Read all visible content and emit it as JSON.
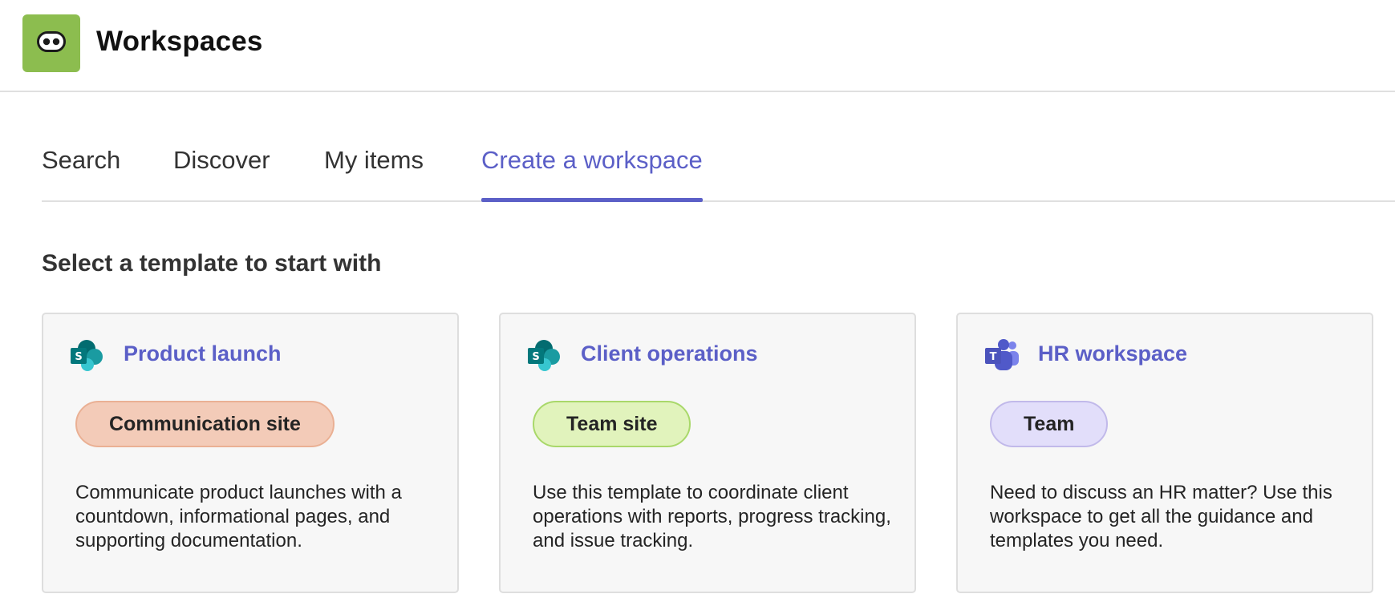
{
  "app": {
    "title": "Workspaces",
    "logo_icon": "eyes-icon",
    "logo_color": "#8cbd4f"
  },
  "tabs": [
    {
      "label": "Search",
      "active": false
    },
    {
      "label": "Discover",
      "active": false
    },
    {
      "label": "My items",
      "active": false
    },
    {
      "label": "Create a workspace",
      "active": true
    }
  ],
  "accent_color": "#5b5fc7",
  "section_title": "Select a template to start with",
  "cards": [
    {
      "title": "Product launch",
      "icon": "sharepoint-icon",
      "badge": "Communication site",
      "badge_color": "#f3cbb8",
      "description": "Communicate product launches with a countdown, informational pages, and supporting documentation."
    },
    {
      "title": "Client operations",
      "icon": "sharepoint-icon",
      "badge": "Team site",
      "badge_color": "#e1f3bc",
      "description": "Use this template to coordinate client operations with reports, progress tracking, and issue tracking."
    },
    {
      "title": "HR workspace",
      "icon": "teams-icon",
      "badge": "Team",
      "badge_color": "#e2defa",
      "description": "Need to discuss an HR matter? Use this workspace to get all the guidance and templates you need."
    }
  ]
}
